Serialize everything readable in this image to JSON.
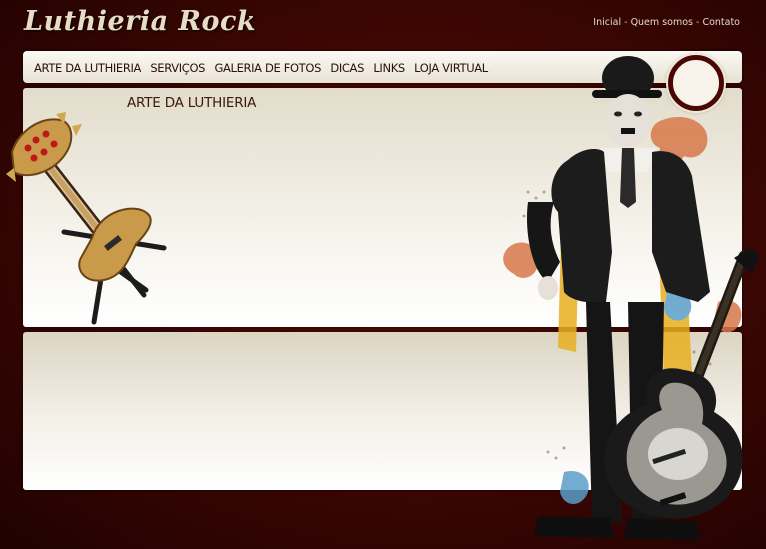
{
  "site": {
    "logo_text": "Luthieria Rock"
  },
  "toplinks": {
    "inicial": "Inicial",
    "quem_somos": "Quem somos",
    "contato": "Contato",
    "separator": " - "
  },
  "nav": {
    "items": [
      {
        "label": "ARTE DA LUTHIERIA"
      },
      {
        "label": "SERVIÇOS"
      },
      {
        "label": "GALERIA DE FOTOS"
      },
      {
        "label": "DICAS"
      },
      {
        "label": "LINKS"
      },
      {
        "label": "LOJA VIRTUAL"
      }
    ]
  },
  "main": {
    "section_title": "ARTE DA LUTHIERIA"
  },
  "colors": {
    "background": "#3a0603",
    "panel": "#f4f1e9",
    "text_dark": "#2a1208",
    "ring": "#4a0804"
  },
  "images": {
    "bass": "bass-guitar-on-stand-illustration",
    "figure": "chaplin-with-electric-guitar-photo"
  }
}
